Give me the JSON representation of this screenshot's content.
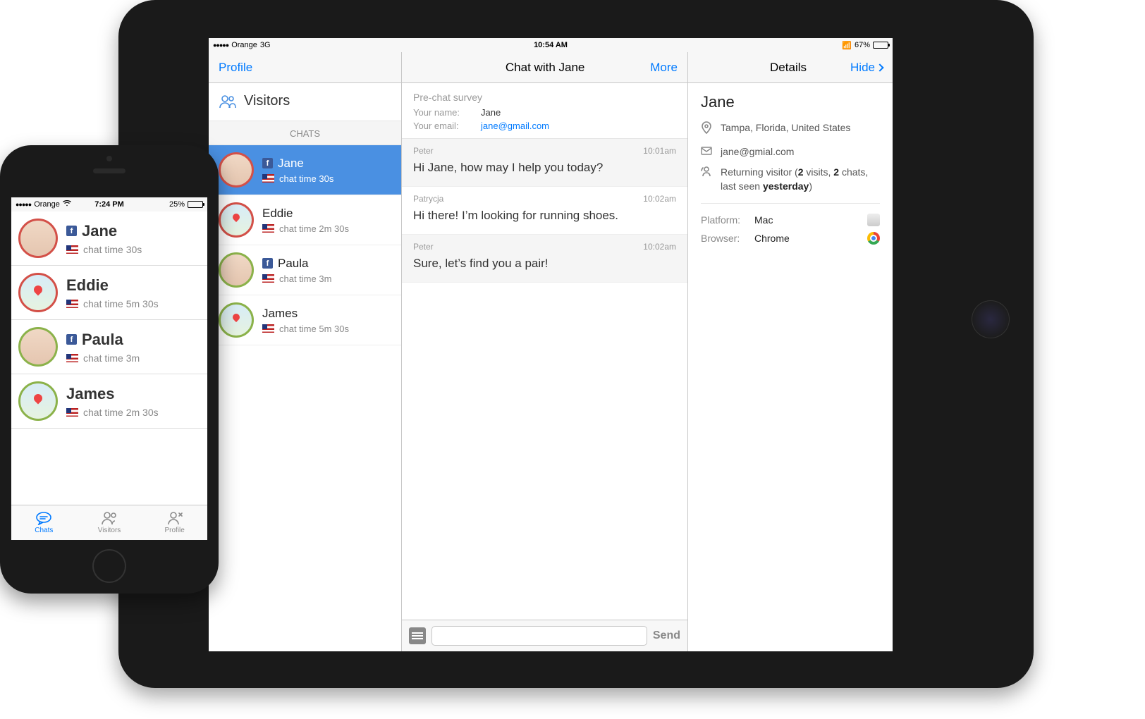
{
  "ipad": {
    "status": {
      "carrier": "Orange",
      "network": "3G",
      "time": "10:54 AM",
      "bt": "✽",
      "battery": "67%"
    },
    "nav": {
      "profile": "Profile",
      "title": "Chat with Jane",
      "more": "More",
      "details": "Details",
      "hide": "Hide"
    },
    "sidebar": {
      "visitors": "Visitors",
      "chats_label": "CHATS",
      "items": [
        {
          "name": "Jane",
          "sub": "chat time 30s",
          "fb": true,
          "ring": "red",
          "avatar": "face",
          "active": true
        },
        {
          "name": "Eddie",
          "sub": "chat time 2m 30s",
          "fb": false,
          "ring": "red",
          "avatar": "map"
        },
        {
          "name": "Paula",
          "sub": "chat time 3m",
          "fb": true,
          "ring": "grn",
          "avatar": "face"
        },
        {
          "name": "James",
          "sub": "chat time 5m 30s",
          "fb": false,
          "ring": "grn",
          "avatar": "map"
        }
      ]
    },
    "prechat": {
      "title": "Pre-chat survey",
      "name_label": "Your name:",
      "name_value": "Jane",
      "email_label": "Your email:",
      "email_value": "jane@gmail.com"
    },
    "messages": [
      {
        "author": "Peter",
        "time": "10:01am",
        "body": "Hi Jane, how may I help you today?",
        "alt": true
      },
      {
        "author": "Patrycja",
        "time": "10:02am",
        "body": "Hi there! I’m looking for running shoes.",
        "alt": false
      },
      {
        "author": "Peter",
        "time": "10:02am",
        "body": "Sure, let’s find you a pair!",
        "alt": true
      }
    ],
    "composer": {
      "send": "Send"
    },
    "details": {
      "name": "Jane",
      "location": "Tampa, Florida, United States",
      "email": "jane@gmial.com",
      "visitor_prefix": "Returning visitor (",
      "visits": "2",
      "visits_word": " visits, ",
      "chats": "2",
      "chats_word": " chats,",
      "lastseen_pre": "last seen ",
      "lastseen_val": "yesterday",
      "lastseen_post": ")",
      "platform_label": "Platform:",
      "platform_value": "Mac",
      "browser_label": "Browser:",
      "browser_value": "Chrome"
    }
  },
  "iphone": {
    "status": {
      "carrier": "Orange",
      "time": "7:24 PM",
      "battery": "25%"
    },
    "items": [
      {
        "name": "Jane",
        "sub": "chat time 30s",
        "fb": true,
        "ring": "red",
        "avatar": "face"
      },
      {
        "name": "Eddie",
        "sub": "chat time 5m 30s",
        "fb": false,
        "ring": "red",
        "avatar": "map"
      },
      {
        "name": "Paula",
        "sub": "chat time 3m",
        "fb": true,
        "ring": "grn",
        "avatar": "face"
      },
      {
        "name": "James",
        "sub": "chat time 2m 30s",
        "fb": false,
        "ring": "grn",
        "avatar": "map"
      }
    ],
    "tabs": {
      "chats": "Chats",
      "visitors": "Visitors",
      "profile": "Profile"
    }
  }
}
